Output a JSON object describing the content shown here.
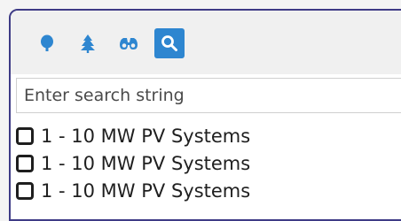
{
  "toolbar": {
    "icons": [
      {
        "name": "deciduous-tree-icon",
        "active": false
      },
      {
        "name": "evergreen-tree-icon",
        "active": false
      },
      {
        "name": "binoculars-icon",
        "active": false
      },
      {
        "name": "search-icon",
        "active": true
      }
    ],
    "accent_color": "#2e86d0",
    "icon_color": "#2e86d0"
  },
  "search": {
    "placeholder": "Enter search string",
    "value": ""
  },
  "list": {
    "items": [
      {
        "label": "1 - 10 MW PV Systems",
        "checked": false
      },
      {
        "label": "1 - 10 MW PV Systems",
        "checked": false
      },
      {
        "label": "1 - 10 MW PV Systems",
        "checked": false
      }
    ]
  },
  "colors": {
    "panel_border": "#3e3b86",
    "toolbar_bg": "#f0f0f0"
  }
}
